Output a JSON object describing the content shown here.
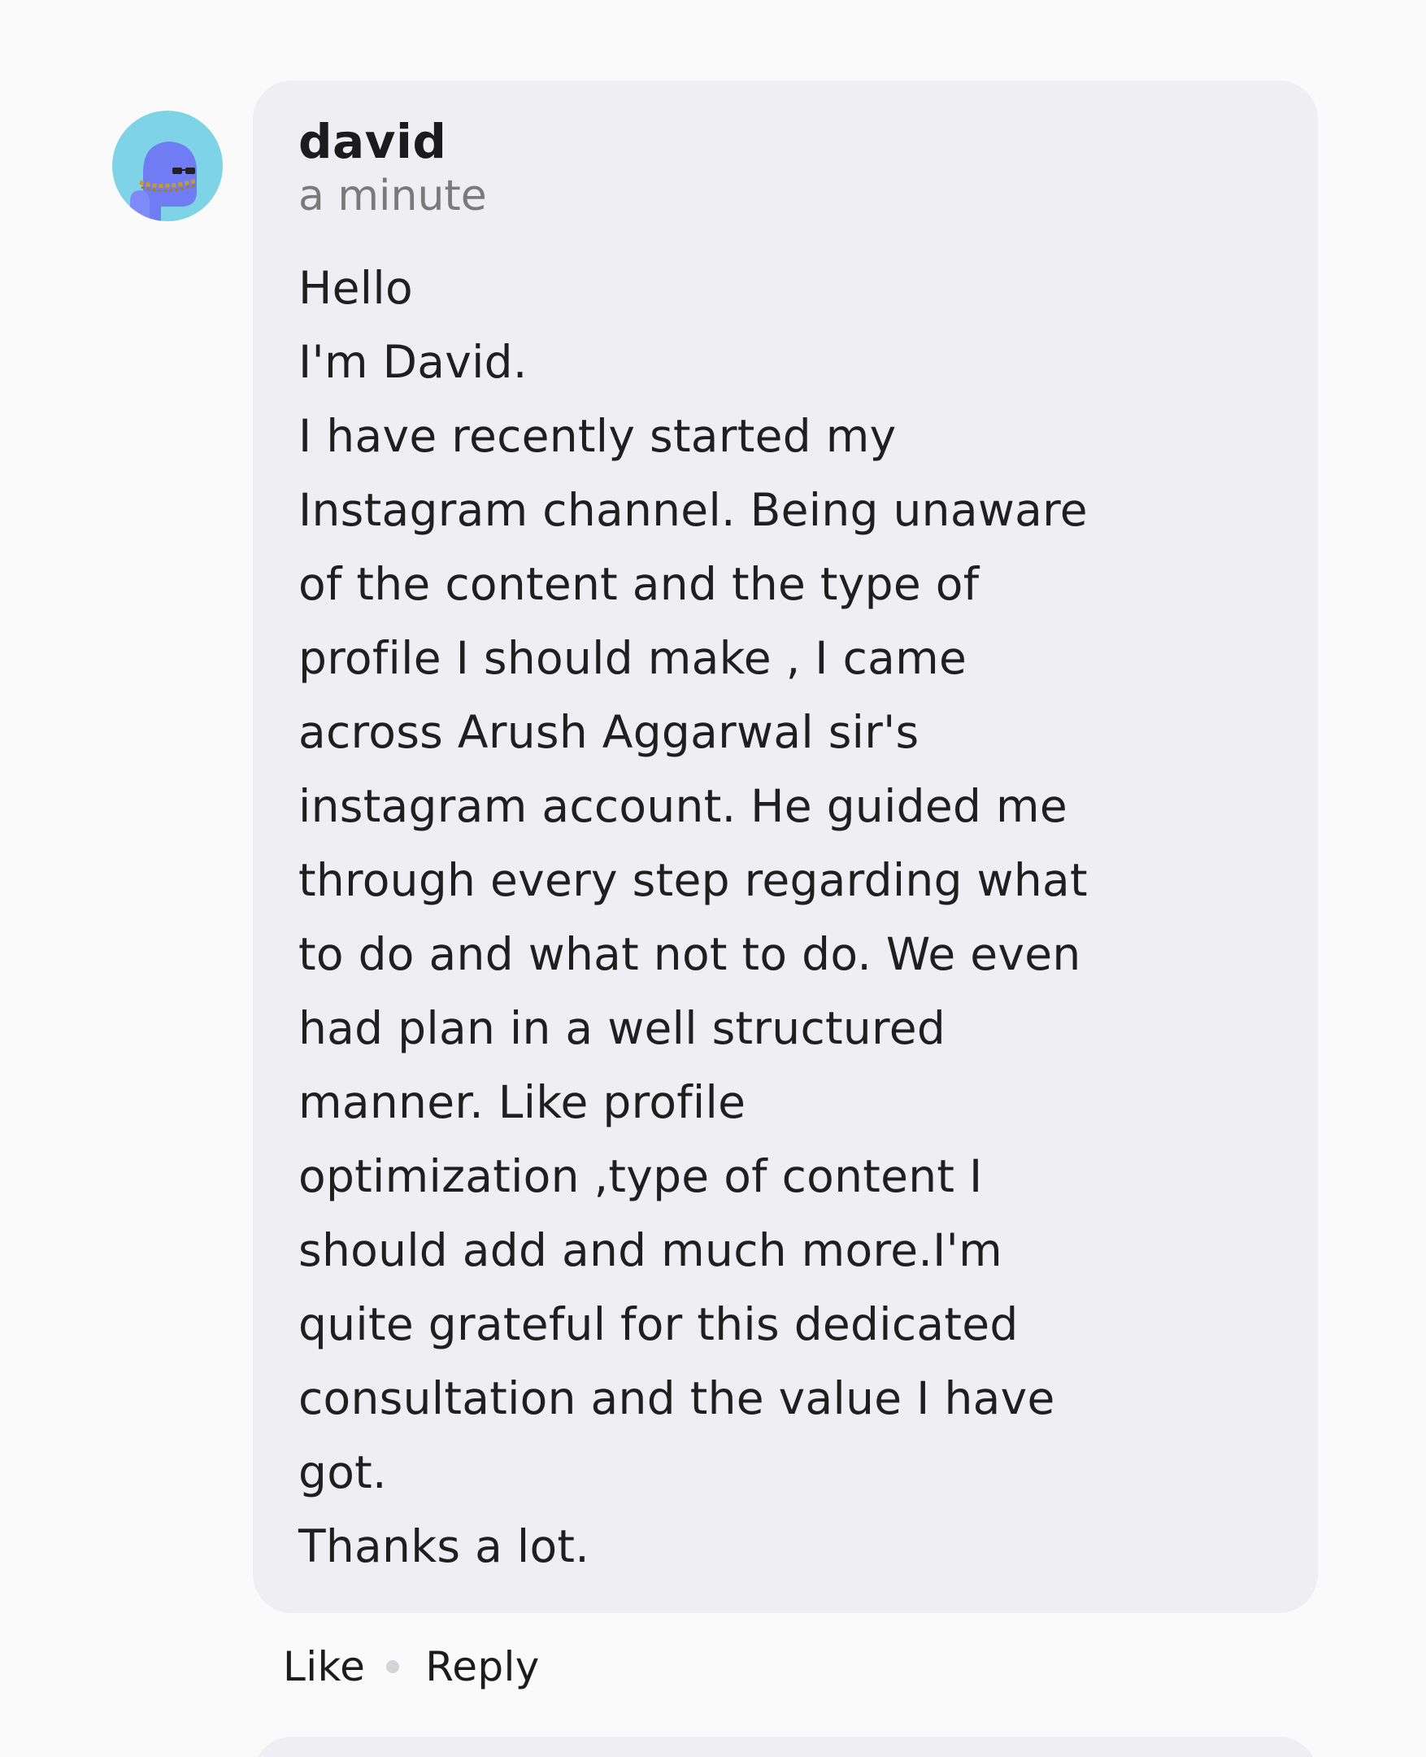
{
  "comment": {
    "author": "david",
    "timestamp": "a minute",
    "avatar_icon": "cartoon-avatar-icon",
    "body_lines": [
      "Hello",
      "I'm David.",
      "I have recently started my",
      "Instagram channel. Being unaware",
      "of the content and the type of",
      "profile I should make , I came",
      "across Arush Aggarwal sir's",
      "instagram account. He guided me",
      "through every step regarding what",
      "to do and what not to do. We even",
      "had plan in a well structured",
      "manner. Like profile",
      "optimization ,type of content I",
      "should add and much more.I'm",
      "quite grateful for this dedicated",
      "consultation and the value I have",
      "got.",
      "Thanks a lot."
    ]
  },
  "actions": {
    "like_label": "Like",
    "reply_label": "Reply"
  },
  "colors": {
    "page_background": "#fafafb",
    "bubble_background": "#efeff3",
    "avatar_background": "#7ed3e6",
    "text": "#1c1c1c",
    "muted_text": "#7a7a7a"
  }
}
